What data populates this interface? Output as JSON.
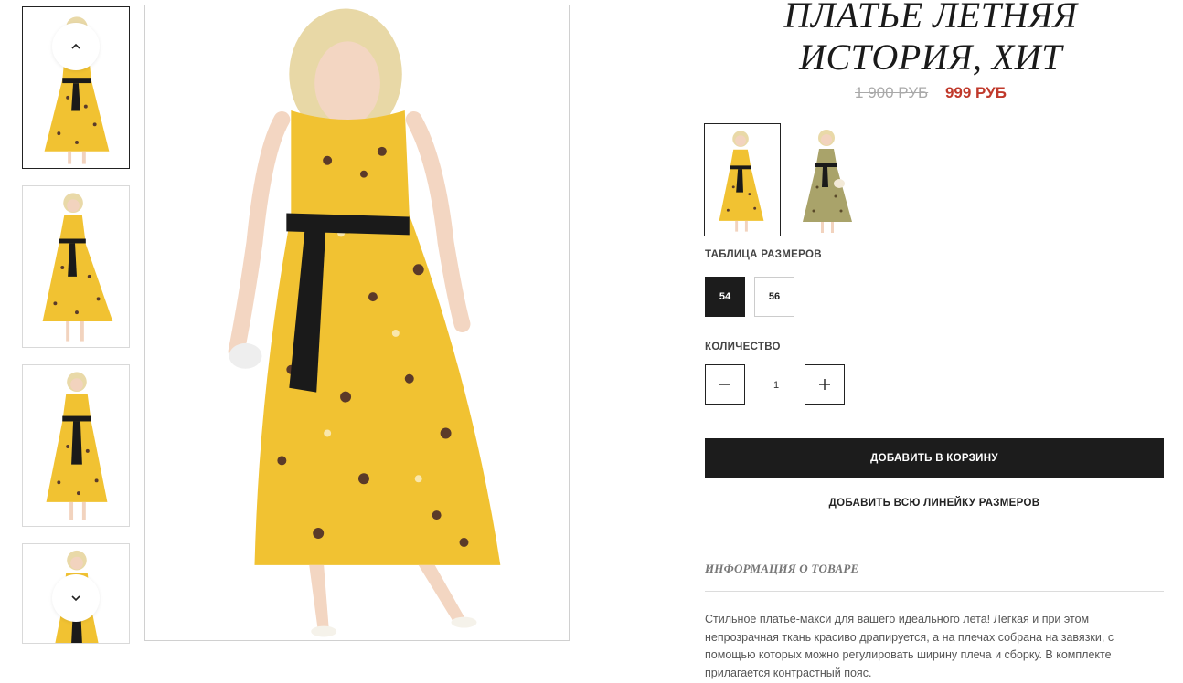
{
  "product": {
    "title": "ПЛАТЬЕ ЛЕТНЯЯ ИСТОРИЯ, ХИТ",
    "old_price": "1 900 РУБ",
    "new_price": "999 РУБ"
  },
  "gallery": {
    "thumbnails": [
      {
        "name": "thumb-1",
        "active": true
      },
      {
        "name": "thumb-2",
        "active": false
      },
      {
        "name": "thumb-3",
        "active": false
      },
      {
        "name": "thumb-4",
        "active": false
      }
    ],
    "up_icon": "chevron-up-icon",
    "down_icon": "chevron-down-icon"
  },
  "colors": {
    "options": [
      {
        "name": "yellow",
        "selected": true
      },
      {
        "name": "olive",
        "selected": false
      }
    ]
  },
  "sizes": {
    "label": "ТАБЛИЦА РАЗМЕРОВ",
    "options": [
      {
        "label": "54",
        "selected": true
      },
      {
        "label": "56",
        "selected": false
      }
    ]
  },
  "quantity": {
    "label": "КОЛИЧЕСТВО",
    "value": "1",
    "minus_icon": "minus-icon",
    "plus_icon": "plus-icon"
  },
  "actions": {
    "add_to_cart": "ДОБАВИТЬ В КОРЗИНУ",
    "add_all_sizes": "ДОБАВИТЬ ВСЮ ЛИНЕЙКУ РАЗМЕРОВ"
  },
  "info": {
    "heading": "ИНФОРМАЦИЯ О ТОВАРЕ",
    "description": "Стильное платье-макси для вашего идеального лета! Легкая и при этом непрозрачная ткань красиво драпируется, а на плечах собрана на завязки, с помощью которых можно регулировать ширину плеча и сборку. В комплекте прилагается контрастный пояс."
  },
  "colors_palette": {
    "accent_price": "#c0392b",
    "old_price": "#a9a9a9",
    "dark": "#1c1c1c",
    "dress_yellow": "#f1c232",
    "dress_olive": "#a9a36a"
  }
}
